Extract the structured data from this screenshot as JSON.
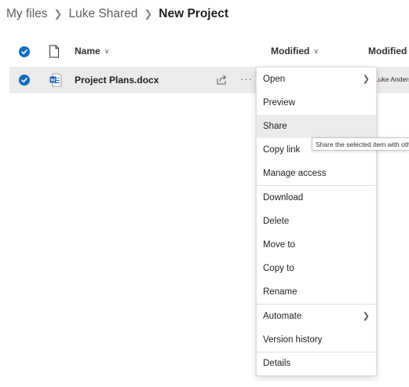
{
  "breadcrumb": {
    "items": [
      "My files",
      "Luke Shared",
      "New Project"
    ]
  },
  "header": {
    "name": "Name",
    "modified": "Modified",
    "modified_by": "Modified By"
  },
  "file_row": {
    "name": "Project Plans.docx",
    "modified_by": "Luke Anderson"
  },
  "context_menu": {
    "items": [
      "Open",
      "Preview",
      "Share",
      "Copy link",
      "Manage access",
      "Download",
      "Delete",
      "Move to",
      "Copy to",
      "Rename",
      "Automate",
      "Version history",
      "Details"
    ]
  },
  "tooltip": {
    "text": "Share the selected item with other people"
  },
  "colors": {
    "accent": "#0f6cbd",
    "selection": "#edebe9",
    "word_blue": "#185abd"
  }
}
